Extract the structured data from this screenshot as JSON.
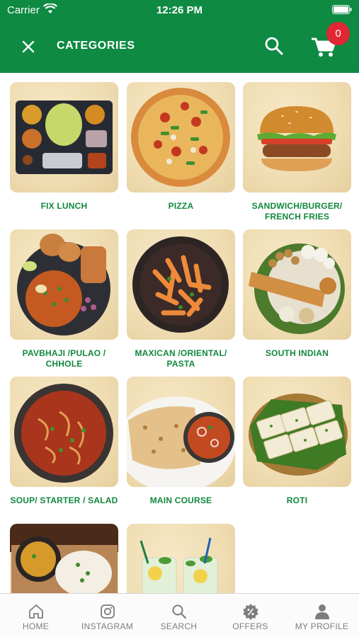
{
  "status_bar": {
    "carrier": "Carrier",
    "time": "12:26 PM"
  },
  "app_bar": {
    "title": "CATEGORIES",
    "cart_count": "0"
  },
  "categories": [
    {
      "label": "FIX LUNCH"
    },
    {
      "label": "PIZZA"
    },
    {
      "label": "SANDWICH/BURGER/\nFRENCH FRIES"
    },
    {
      "label": "PAVBHAJI /PULAO /\nCHHOLE"
    },
    {
      "label": "MAXICAN /ORIENTAL/\nPASTA"
    },
    {
      "label": "SOUTH INDIAN"
    },
    {
      "label": "SOUP/ STARTER / SALAD"
    },
    {
      "label": "MAIN COURSE"
    },
    {
      "label": "ROTI"
    },
    {
      "label": ""
    },
    {
      "label": ""
    }
  ],
  "bottom_nav": [
    {
      "label": "HOME",
      "icon": "home-icon"
    },
    {
      "label": "INSTAGRAM",
      "icon": "instagram-icon"
    },
    {
      "label": "SEARCH",
      "icon": "search-icon"
    },
    {
      "label": "OFFERS",
      "icon": "offers-icon"
    },
    {
      "label": "MY PROFILE",
      "icon": "profile-icon"
    }
  ],
  "colors": {
    "brand_green": "#0e8a43",
    "label_green": "#12883e",
    "badge_red": "#e02733",
    "nav_gray": "#7d7d7d"
  }
}
